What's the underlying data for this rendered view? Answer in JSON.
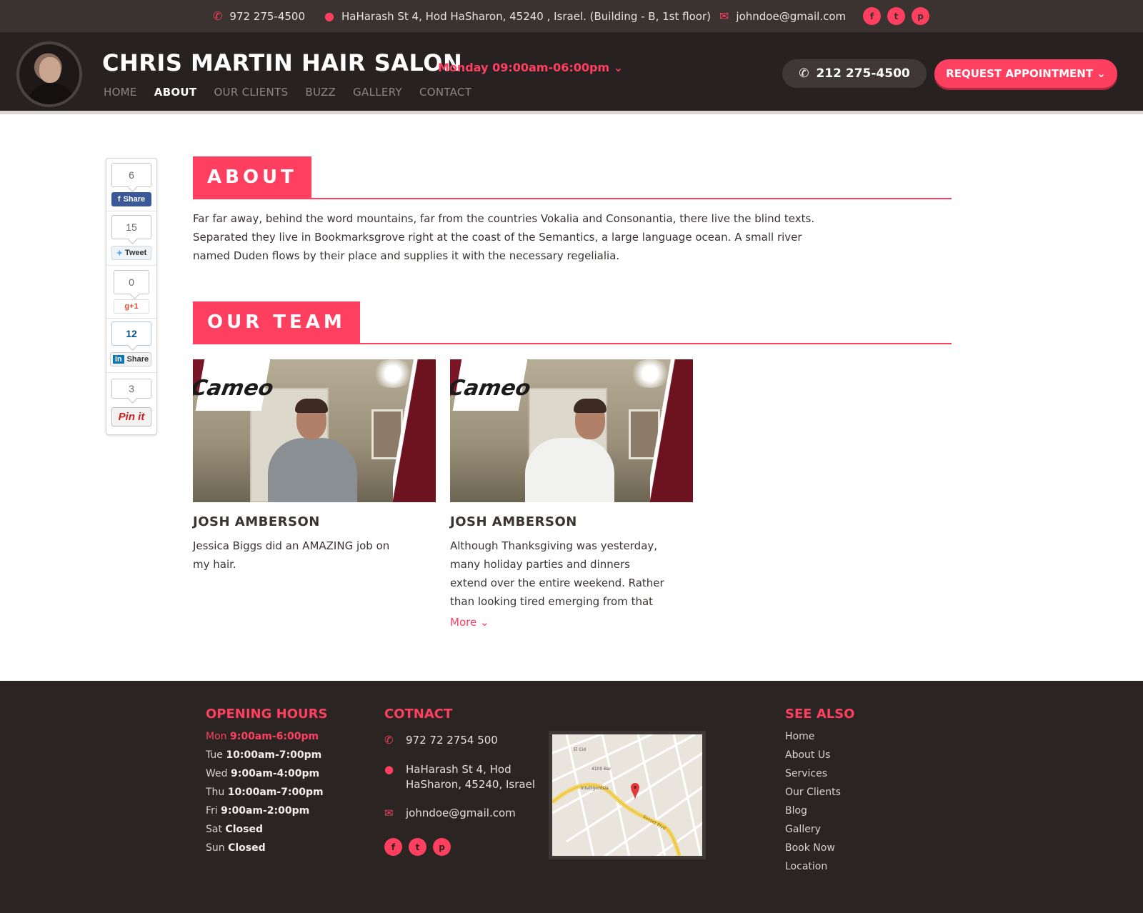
{
  "topbar": {
    "phone": "972 275-4500",
    "address": "HaHarash St 4, Hod HaSharon, 45240 , Israel. (Building - B, 1st floor)",
    "email": "johndoe@gmail.com",
    "social": [
      "facebook",
      "twitter",
      "pinterest"
    ]
  },
  "header": {
    "title": "CHRIS MARTIN HAIR SALON",
    "hours": "Monday 09:00am-06:00pm",
    "nav": [
      "HOME",
      "ABOUT",
      "OUR CLIENTS",
      "BUZZ",
      "GALLERY",
      "CONTACT"
    ],
    "active_nav": "ABOUT",
    "phone_button": "212 275-4500",
    "request_button": "REQUEST APPOINTMENT"
  },
  "share": {
    "facebook": {
      "count": "6",
      "label": "Share"
    },
    "twitter": {
      "count": "15",
      "label": "Tweet"
    },
    "gplus": {
      "count": "0",
      "label": "+1"
    },
    "linkedin": {
      "count": "12",
      "label": "Share"
    },
    "pinterest": {
      "count": "3",
      "label": "Pin it"
    }
  },
  "about": {
    "heading": "ABOUT",
    "text": "Far far away, behind the word mountains, far from the countries Vokalia and Consonantia, there live the blind texts. Separated they live in Bookmarksgrove right at the coast of the Semantics, a large language ocean. A small river named Duden flows by their place and supplies it with the necessary regelialia."
  },
  "team": {
    "heading": "OUR TEAM",
    "photo_logo": "Cameo",
    "members": [
      {
        "name": "JOSH AMBERSON",
        "text": "Jessica Biggs did an AMAZING job on my hair."
      },
      {
        "name": "JOSH AMBERSON",
        "text": "Although Thanksgiving was yesterday, many holiday parties and dinners extend over the entire weekend. Rather than looking tired emerging from that turkey",
        "more": "More"
      }
    ]
  },
  "footer": {
    "hours_title": "OPENING HOURS",
    "hours": [
      {
        "day": "Mon",
        "time": "9:00am-6:00pm"
      },
      {
        "day": "Tue",
        "time": "10:00am-7:00pm"
      },
      {
        "day": "Wed",
        "time": "9:00am-4:00pm"
      },
      {
        "day": "Thu",
        "time": "10:00am-7:00pm"
      },
      {
        "day": "Fri",
        "time": "9:00am-2:00pm"
      },
      {
        "day": "Sat",
        "time": "Closed"
      },
      {
        "day": "Sun",
        "time": "Closed"
      }
    ],
    "contact_title": "COTNACT",
    "contact_phone": "972 72 2754 500",
    "contact_address_1": "HaHarash St 4, Hod",
    "contact_address_2": "HaSharon, 45240, Israel",
    "contact_email": "johndoe@gmail.com",
    "map_labels": [
      "El Cid",
      "4100 Bar",
      "Intelligentsia",
      "Sunset Blvd"
    ],
    "see_title": "SEE ALSO",
    "see_links": [
      "Home",
      "About Us",
      "Services",
      "Our Clients",
      "Blog",
      "Gallery",
      "Book Now",
      "Location"
    ]
  },
  "colors": {
    "accent": "#ff3f5f",
    "dark": "#272221",
    "footer": "#2a2423"
  }
}
